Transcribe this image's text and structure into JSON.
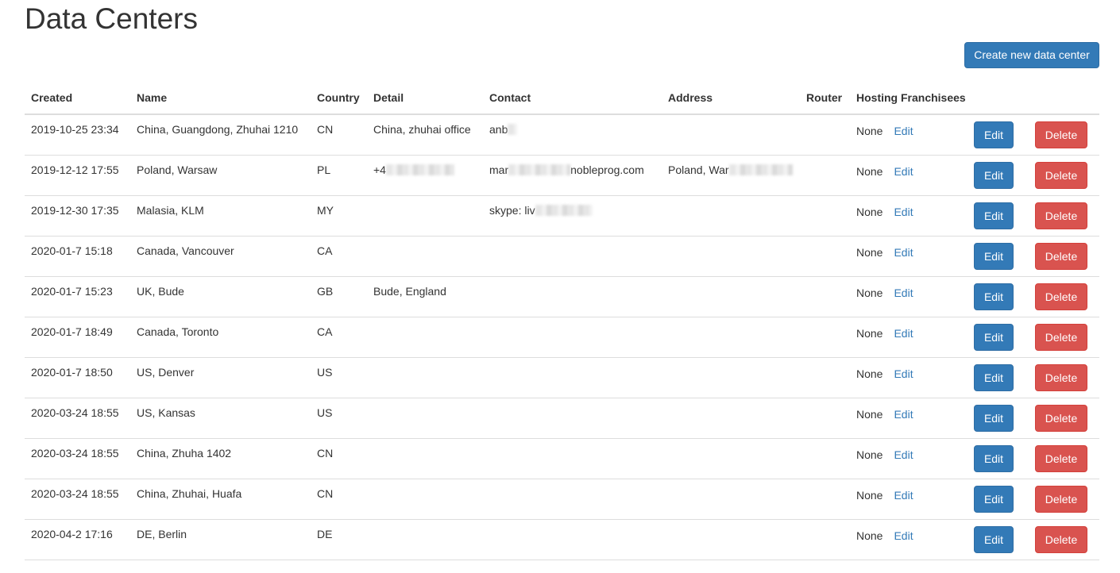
{
  "page": {
    "title": "Data Centers",
    "create_button": "Create new data center"
  },
  "table": {
    "headers": {
      "created": "Created",
      "name": "Name",
      "country": "Country",
      "detail": "Detail",
      "contact": "Contact",
      "address": "Address",
      "router": "Router",
      "franchisees": "Hosting Franchisees"
    },
    "rows": [
      {
        "created": "2019-10-25 23:34",
        "name": "China, Guangdong, Zhuhai 1210",
        "country": "CN",
        "detail": "China, zhuhai office",
        "contact": "anb",
        "address": "",
        "router": "",
        "franchisees": "None",
        "fr_edit": "Edit",
        "edit": "Edit",
        "delete": "Delete"
      },
      {
        "created": "2019-12-12 17:55",
        "name": "Poland, Warsaw",
        "country": "PL",
        "detail": "+4",
        "contact": "mar",
        "contact_suffix": "nobleprog.com",
        "address": "Poland, War",
        "router": "",
        "franchisees": "None",
        "fr_edit": "Edit",
        "edit": "Edit",
        "delete": "Delete"
      },
      {
        "created": "2019-12-30 17:35",
        "name": "Malasia, KLM",
        "country": "MY",
        "detail": "",
        "contact": "skype: liv",
        "address": "",
        "router": "",
        "franchisees": "None",
        "fr_edit": "Edit",
        "edit": "Edit",
        "delete": "Delete"
      },
      {
        "created": "2020-01-7 15:18",
        "name": "Canada, Vancouver",
        "country": "CA",
        "detail": "",
        "contact": "",
        "address": "",
        "router": "",
        "franchisees": "None",
        "fr_edit": "Edit",
        "edit": "Edit",
        "delete": "Delete"
      },
      {
        "created": "2020-01-7 15:23",
        "name": "UK, Bude",
        "country": "GB",
        "detail": "Bude, England",
        "contact": "",
        "address": "",
        "router": "",
        "franchisees": "None",
        "fr_edit": "Edit",
        "edit": "Edit",
        "delete": "Delete"
      },
      {
        "created": "2020-01-7 18:49",
        "name": "Canada, Toronto",
        "country": "CA",
        "detail": "",
        "contact": "",
        "address": "",
        "router": "",
        "franchisees": "None",
        "fr_edit": "Edit",
        "edit": "Edit",
        "delete": "Delete"
      },
      {
        "created": "2020-01-7 18:50",
        "name": "US, Denver",
        "country": "US",
        "detail": "",
        "contact": "",
        "address": "",
        "router": "",
        "franchisees": "None",
        "fr_edit": "Edit",
        "edit": "Edit",
        "delete": "Delete"
      },
      {
        "created": "2020-03-24 18:55",
        "name": "US, Kansas",
        "country": "US",
        "detail": "",
        "contact": "",
        "address": "",
        "router": "",
        "franchisees": "None",
        "fr_edit": "Edit",
        "edit": "Edit",
        "delete": "Delete"
      },
      {
        "created": "2020-03-24 18:55",
        "name": "China, Zhuha 1402",
        "country": "CN",
        "detail": "",
        "contact": "",
        "address": "",
        "router": "",
        "franchisees": "None",
        "fr_edit": "Edit",
        "edit": "Edit",
        "delete": "Delete"
      },
      {
        "created": "2020-03-24 18:55",
        "name": "China, Zhuhai, Huafa",
        "country": "CN",
        "detail": "",
        "contact": "",
        "address": "",
        "router": "",
        "franchisees": "None",
        "fr_edit": "Edit",
        "edit": "Edit",
        "delete": "Delete"
      },
      {
        "created": "2020-04-2 17:16",
        "name": "DE, Berlin",
        "country": "DE",
        "detail": "",
        "contact": "",
        "address": "",
        "router": "",
        "franchisees": "None",
        "fr_edit": "Edit",
        "edit": "Edit",
        "delete": "Delete"
      }
    ]
  },
  "colors": {
    "primary": "#337ab7",
    "danger": "#d9534f",
    "text": "#333333",
    "border": "#dddddd"
  }
}
